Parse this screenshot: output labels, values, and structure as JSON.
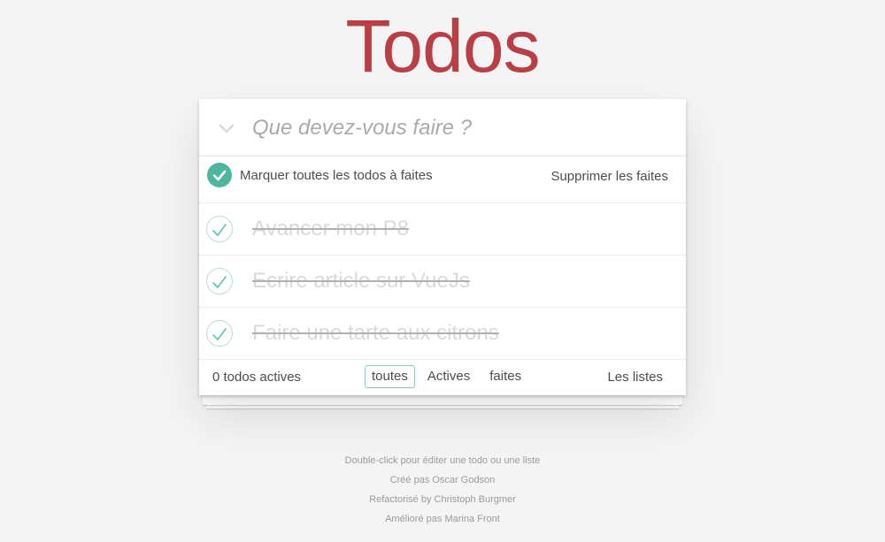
{
  "header": {
    "title": "Todos"
  },
  "new_todo": {
    "placeholder": "Que devez-vous faire ?"
  },
  "mark_all": {
    "label": "Marquer toutes les todos à faites",
    "clear_label": "Supprimer les faites"
  },
  "todos": [
    {
      "title": "Avancer mon P8",
      "completed": true
    },
    {
      "title": "Ecrire article sur VueJs",
      "completed": true
    },
    {
      "title": "Faire une tarte aux citrons",
      "completed": true
    }
  ],
  "footer": {
    "count_label": "0 todos actives",
    "filters": [
      "toutes",
      "Actives",
      "faites"
    ],
    "selected_filter": "toutes",
    "lists_label": "Les listes"
  },
  "info": [
    "Double-click pour éditer une todo ou une liste",
    "Créé pas Oscar Godson",
    "Refactorisé by Christoph Burgmer",
    "Amélioré pas Marina Front"
  ],
  "colors": {
    "title": "#b83f45",
    "accent": "#4db6a1",
    "background": "#f4f4f4"
  }
}
